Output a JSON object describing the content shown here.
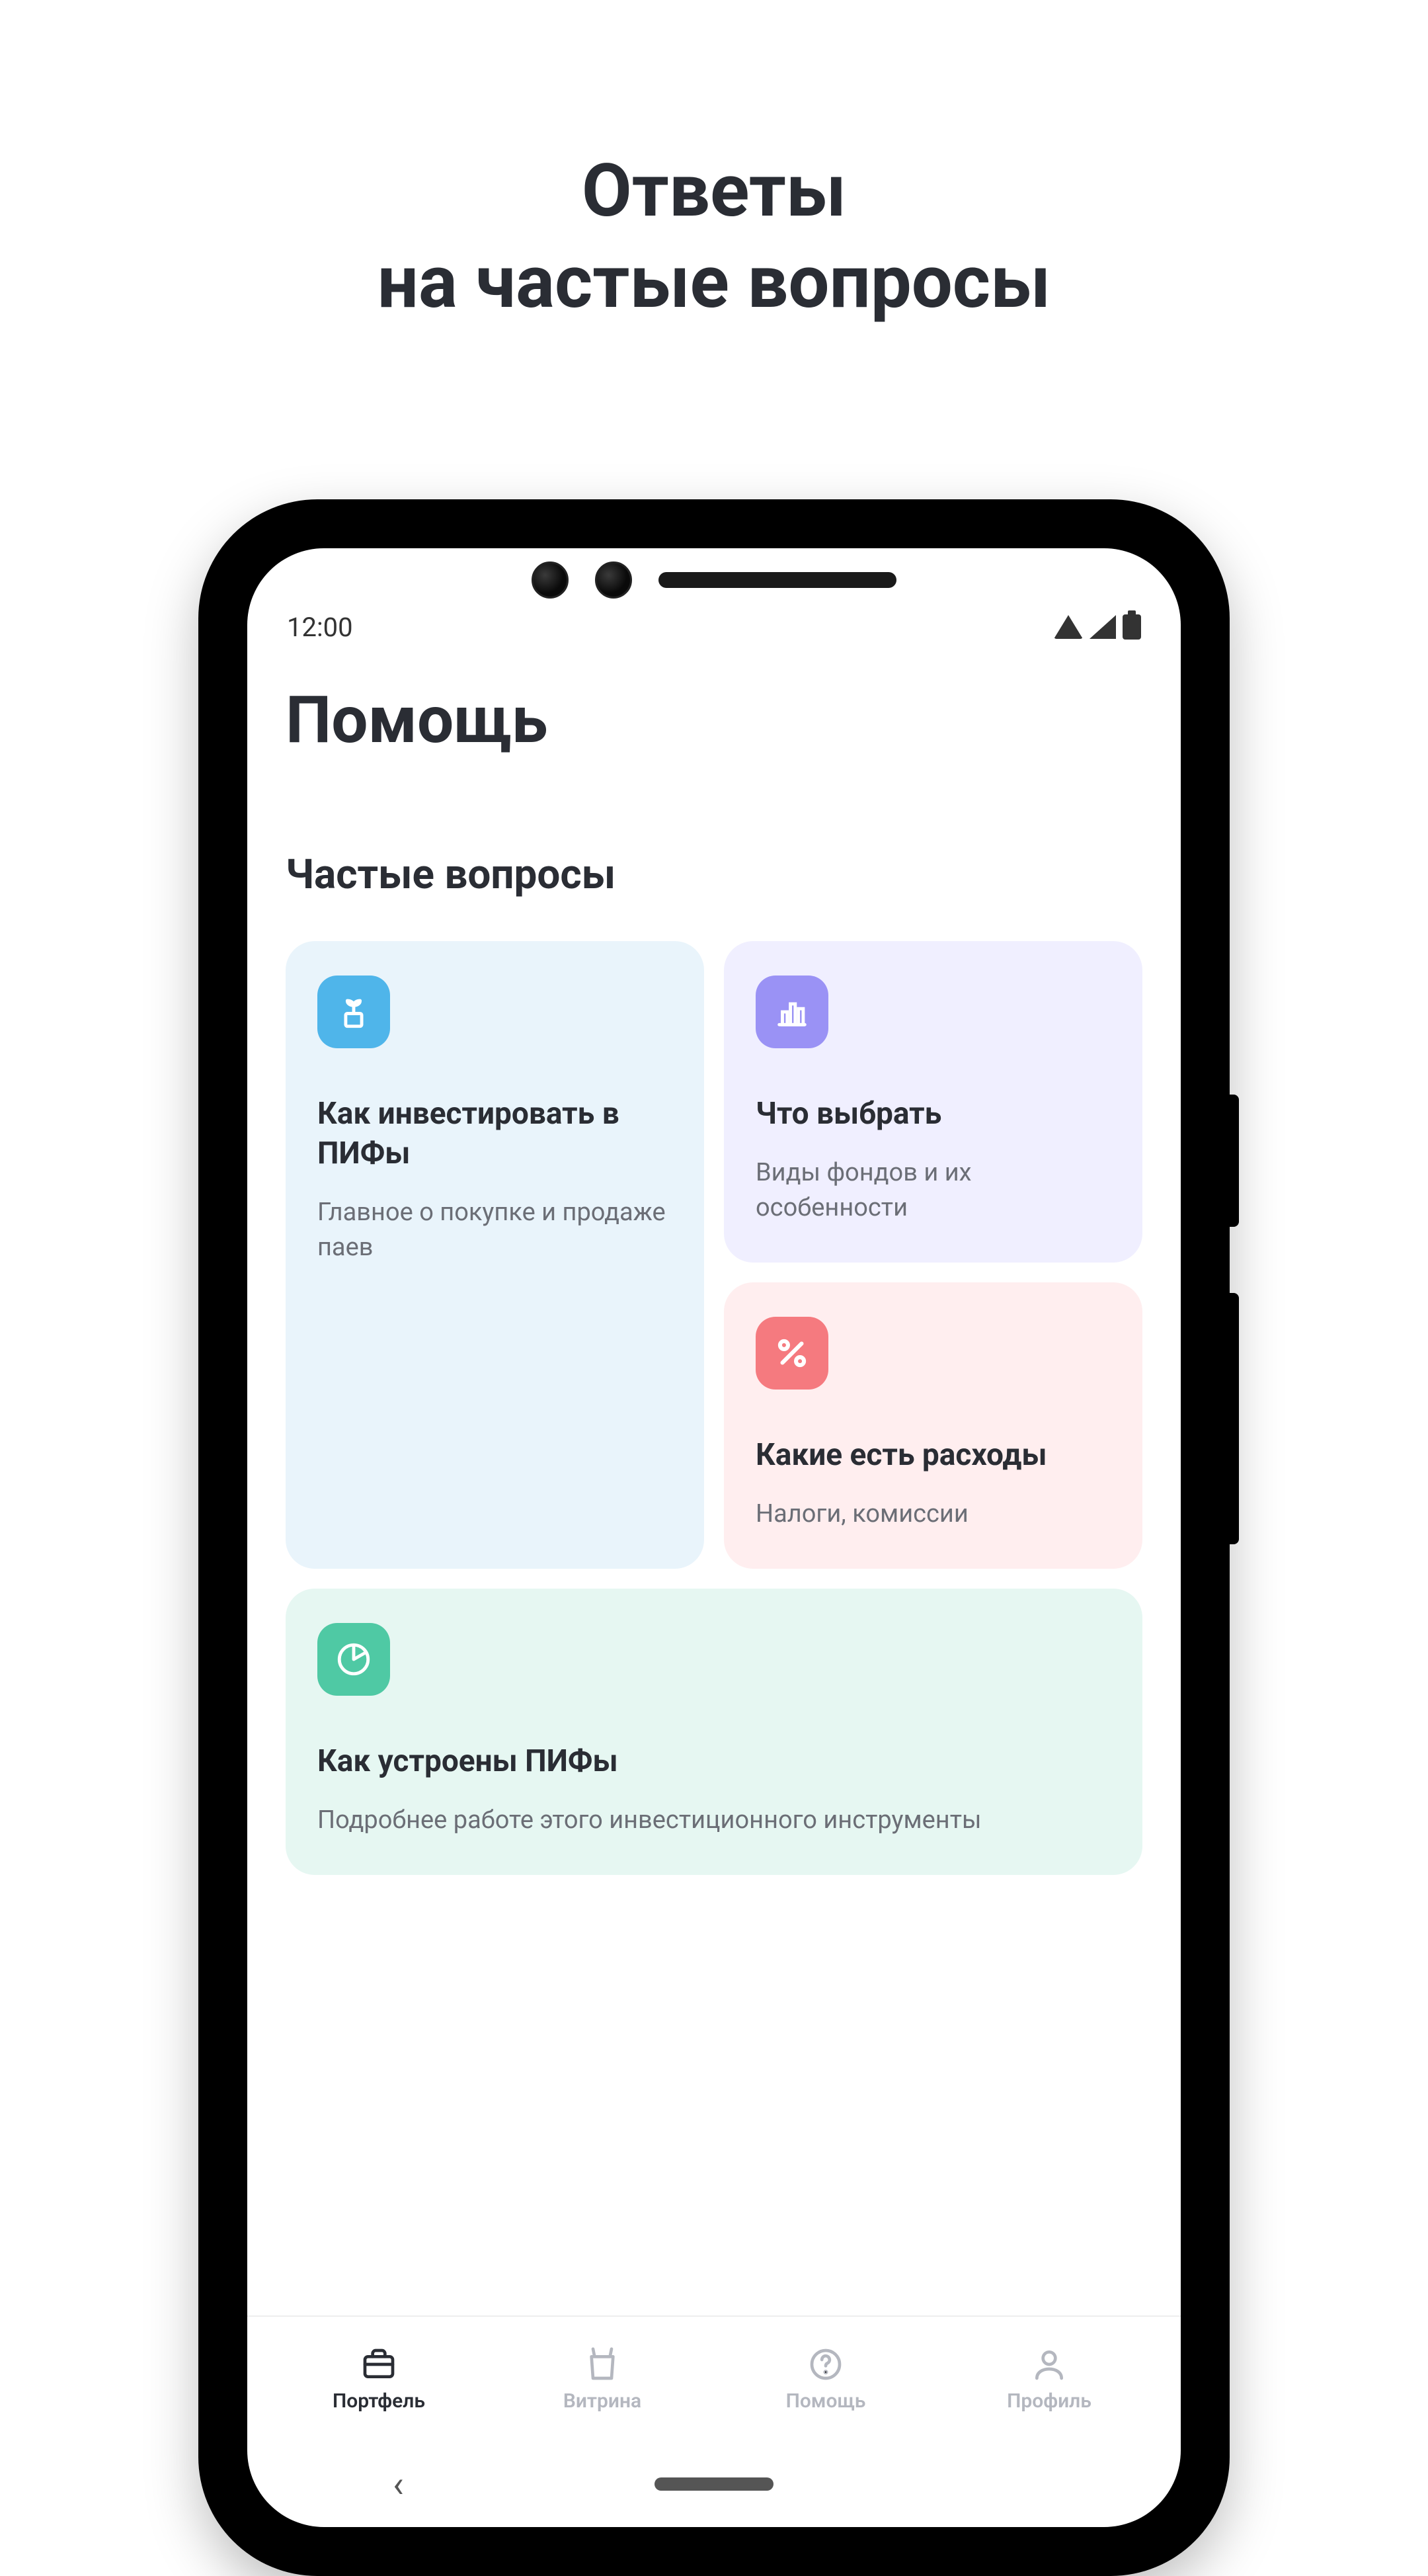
{
  "page_title_line1": "Ответы",
  "page_title_line2": "на частые вопросы",
  "status": {
    "time": "12:00"
  },
  "app": {
    "title": "Помощь",
    "section_title": "Частые вопросы",
    "cards": {
      "invest": {
        "title": "Как инвестировать в ПИФы",
        "sub": "Главное о покупке и продаже паев"
      },
      "choose": {
        "title": "Что выбрать",
        "sub": "Виды фондов и их особенности"
      },
      "costs": {
        "title": "Какие есть расходы",
        "sub": "Налоги, комиссии"
      },
      "how_works": {
        "title": "Как устроены ПИФы",
        "sub": "Подробнее работе этого инвестиционного инструменты"
      }
    }
  },
  "nav": {
    "portfolio": "Портфель",
    "showcase": "Витрина",
    "help": "Помощь",
    "profile": "Профиль"
  }
}
